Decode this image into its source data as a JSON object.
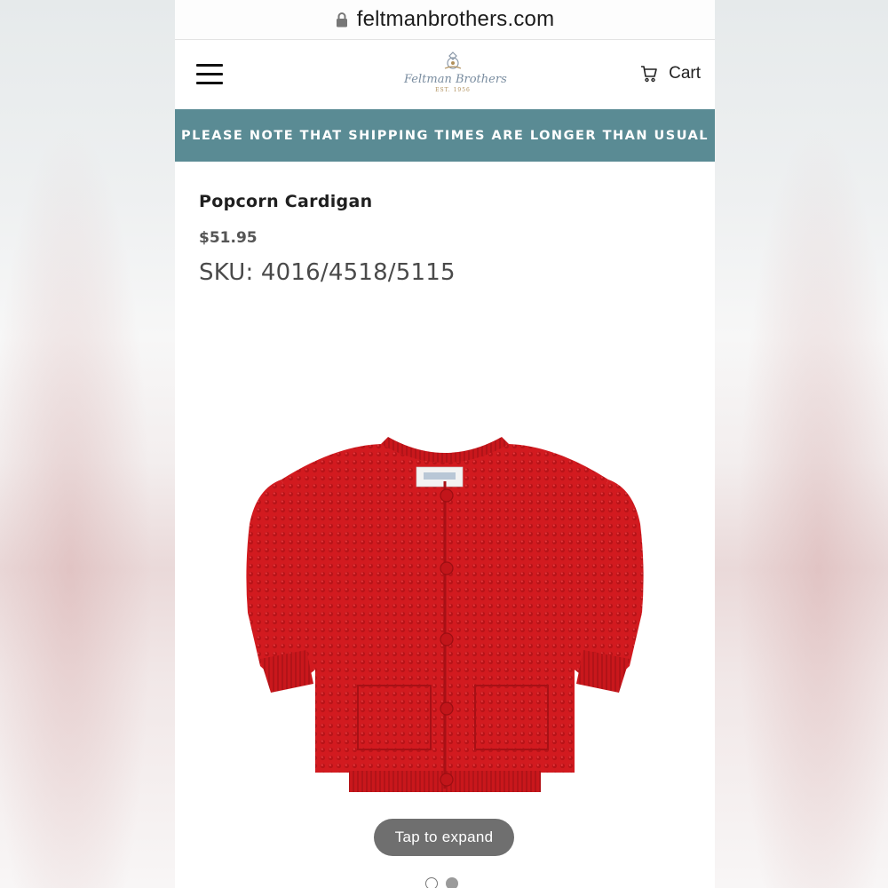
{
  "browser": {
    "url": "feltmanbrothers.com"
  },
  "header": {
    "menu_icon": "hamburger-menu-icon",
    "logo": {
      "name": "Feltman Brothers",
      "est": "EST. 1956"
    },
    "cart_label": "Cart",
    "cart_icon": "shopping-cart-icon"
  },
  "banner": {
    "text": "PLEASE NOTE THAT SHIPPING TIMES ARE LONGER THAN USUAL",
    "color": "#5a8b94"
  },
  "product": {
    "title": "Popcorn Cardigan",
    "price": "$51.95",
    "sku": "SKU: 4016/4518/5115",
    "image_color": "#d21a1f"
  },
  "gallery": {
    "expand_label": "Tap to expand",
    "slides": 2,
    "active_slide": 2
  }
}
